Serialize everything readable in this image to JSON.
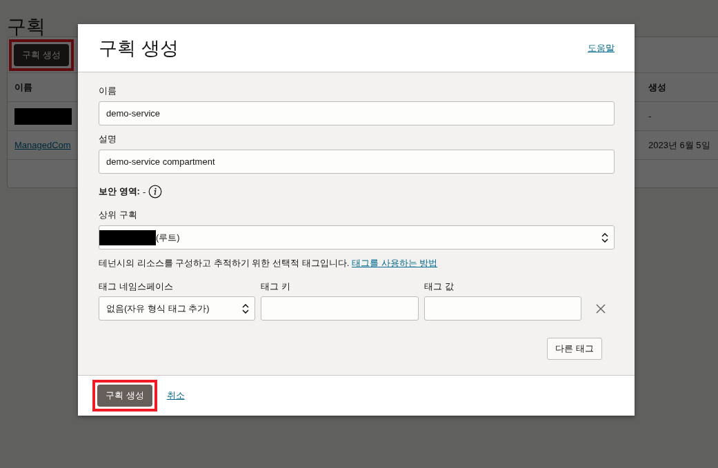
{
  "page": {
    "title": "구획",
    "create_button": {
      "label": "구획 생성",
      "highlighted": true
    },
    "table": {
      "columns": [
        "이름",
        "생성"
      ],
      "rows": [
        {
          "kind": "redacted",
          "created": "-"
        },
        {
          "kind": "link",
          "name": "ManagedCom",
          "created": "2023년 6월 5일"
        }
      ]
    }
  },
  "dialog": {
    "title": "구획 생성",
    "help_link": "도움말",
    "name": {
      "label": "이름",
      "value": "demo-service"
    },
    "description": {
      "label": "설명",
      "value": "demo-service compartment"
    },
    "security_zone": {
      "label": "보안 영역:",
      "value": "-"
    },
    "parent": {
      "label": "상위 구획",
      "redacted": true,
      "value": "(루트)"
    },
    "tags_note": {
      "text": "테넌시의 리소스를 구성하고 추적하기 위한 선택적 태그입니다.",
      "link": "태그를 사용하는 방법"
    },
    "tag_columns": [
      "태그 네임스페이스",
      "태그 키",
      "태그 값"
    ],
    "tag_row": {
      "namespace": "없음(자유 형식 태그 추가)"
    },
    "more_tags_button": "다른 태그",
    "footer": {
      "create_button": {
        "label": "구획 생성",
        "highlighted": true
      },
      "cancel_link": "취소"
    }
  }
}
